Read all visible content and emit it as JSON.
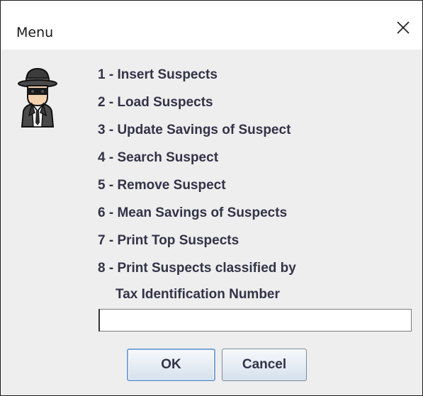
{
  "window": {
    "title": "Menu",
    "close_icon": "close-x-icon"
  },
  "icon": {
    "name": "incognito-spy-icon"
  },
  "menu": {
    "options": [
      "1 - Insert Suspects",
      "2 - Load Suspects",
      "3 - Update Savings of Suspect",
      "4 - Search Suspect",
      "5 - Remove Suspect",
      "6 - Mean Savings of Suspects",
      "7 - Print Top Suspects",
      "8 - Print Suspects classified by",
      "Tax Identification Number"
    ]
  },
  "input": {
    "value": ""
  },
  "buttons": {
    "ok_label": "OK",
    "cancel_label": "Cancel"
  }
}
